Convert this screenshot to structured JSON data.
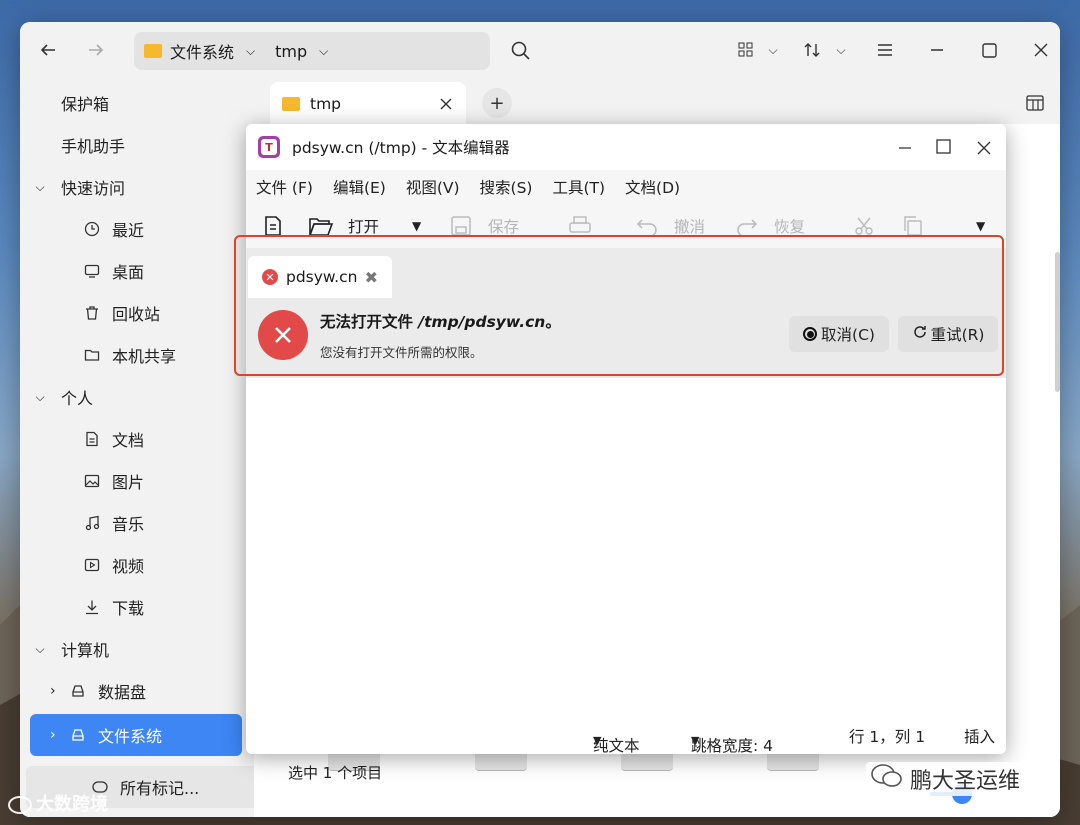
{
  "file_manager": {
    "address": {
      "root": "文件系统",
      "current": "tmp"
    },
    "sidebar": {
      "items": [
        {
          "label": "保护箱"
        },
        {
          "label": "手机助手"
        },
        {
          "label": "快速访问"
        },
        {
          "label": "最近"
        },
        {
          "label": "桌面"
        },
        {
          "label": "回收站"
        },
        {
          "label": "本机共享"
        },
        {
          "label": "个人"
        },
        {
          "label": "文档"
        },
        {
          "label": "图片"
        },
        {
          "label": "音乐"
        },
        {
          "label": "视频"
        },
        {
          "label": "下载"
        },
        {
          "label": "计算机"
        },
        {
          "label": "数据盘"
        },
        {
          "label": "文件系统"
        }
      ],
      "tags_label": "所有标记..."
    },
    "tab": {
      "label": "tmp"
    },
    "status": "选中 1 个项目"
  },
  "editor": {
    "title": "pdsyw.cn (/tmp) - 文本编辑器",
    "menu": [
      "文件 (F)",
      "编辑(E)",
      "视图(V)",
      "搜索(S)",
      "工具(T)",
      "文档(D)"
    ],
    "toolbar": {
      "open": "打开",
      "save": "保存",
      "undo": "撤消",
      "redo": "恢复"
    },
    "doc_tab": "pdsyw.cn",
    "error": {
      "title_prefix": "无法打开文件 ",
      "title_path": "/tmp/pdsyw.cn",
      "title_suffix": "。",
      "detail": "您没有打开文件所需的权限。",
      "cancel": "取消(C)",
      "retry": "重试(R)"
    },
    "status": {
      "syntax": "纯文本",
      "tab_width": "跳格宽度: 4",
      "position": "行 1，列 1",
      "mode": "插入"
    }
  },
  "watermarks": {
    "left": "大数跨境",
    "right": "鹏大圣运维"
  },
  "colors": {
    "accent": "#3d86f4",
    "error": "#e24a4a",
    "highlight": "#d9442c"
  }
}
